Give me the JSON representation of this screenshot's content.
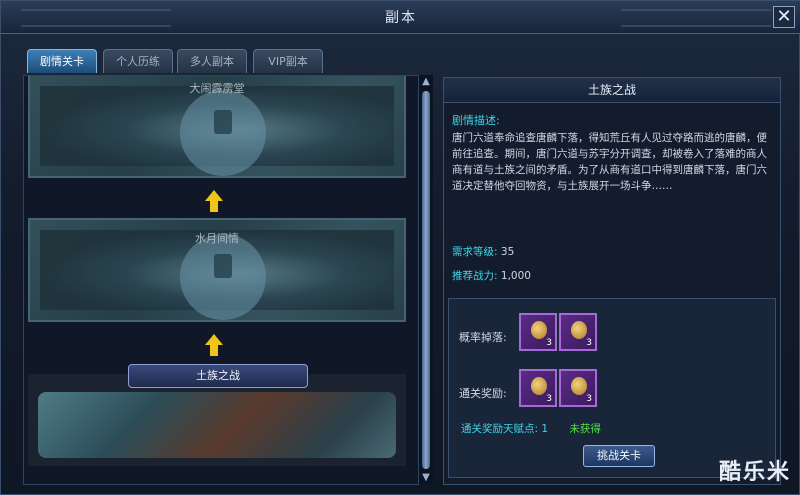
{
  "window": {
    "title": "副本",
    "close_label": "✕"
  },
  "tabs": [
    {
      "label": "剧情关卡",
      "active": true
    },
    {
      "label": "个人历练",
      "active": false
    },
    {
      "label": "多人副本",
      "active": false
    },
    {
      "label": "VIP副本",
      "active": false
    }
  ],
  "stages": [
    {
      "name": "大闹霹雳堂",
      "locked": true
    },
    {
      "name": "水月间情",
      "locked": true
    },
    {
      "name": "土族之战",
      "locked": false,
      "selected": true
    }
  ],
  "detail": {
    "title": "土族之战",
    "desc_label": "剧情描述:",
    "desc_text": "唐门六道奉命追查唐麟下落，得知荒丘有人见过夺路而逃的唐麟，便前往追查。期间，唐门六道与苏宇分开调查，却被卷入了落难的商人商有道与土族之间的矛盾。为了从商有道口中得到唐麟下落，唐门六道决定替他夺回物资，与土族展开一场斗争……",
    "level_label": "需求等级:",
    "level_value": "35",
    "power_label": "推荐战力:",
    "power_value": "1,000",
    "drop_label": "概率掉落:",
    "drop_items": [
      {
        "icon": "treasure-bag-icon",
        "qty": "3"
      },
      {
        "icon": "treasure-bag-icon",
        "qty": "3"
      }
    ],
    "clear_label": "通关奖励:",
    "clear_items": [
      {
        "icon": "treasure-bag-icon",
        "qty": "3"
      },
      {
        "icon": "treasure-bag-icon",
        "qty": "3"
      }
    ],
    "talent_label": "通关奖励天赋点: 1",
    "talent_status": "未获得",
    "challenge_label": "挑战关卡"
  },
  "watermark": "酷乐米",
  "colors": {
    "accent": "#3fd6e6",
    "status_green": "#54e24a",
    "arrow": "#f0c419"
  }
}
